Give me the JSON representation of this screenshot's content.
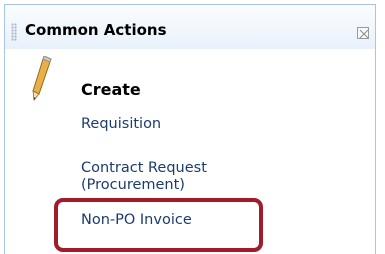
{
  "panel": {
    "title": "Common Actions",
    "close_icon": "close-icon",
    "grip_icon": "drag-grip-icon"
  },
  "section": {
    "icon": "pencil-icon",
    "heading": "Create"
  },
  "actions": [
    {
      "label": "Requisition"
    },
    {
      "label": "Contract Request (Procurement)"
    },
    {
      "label": "Non-PO Invoice"
    }
  ],
  "colors": {
    "link": "#1a3c6e",
    "panel_border": "#a9c4e6",
    "highlight": "#a01c2a"
  }
}
